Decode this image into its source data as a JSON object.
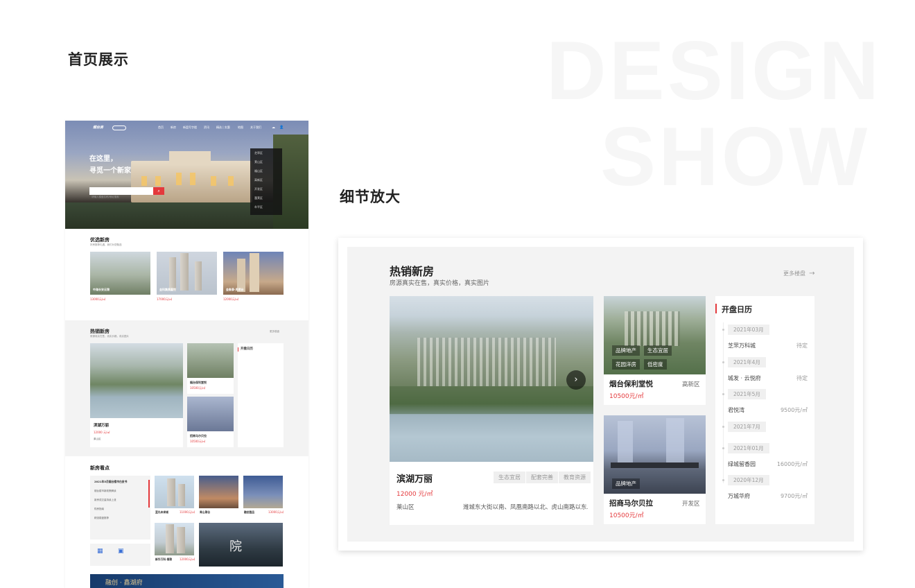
{
  "page": {
    "section_home": "首页展示",
    "section_detail": "细节放大",
    "ghost_line1": "DESIGN",
    "ghost_line2": "SHOW"
  },
  "mock": {
    "nav": [
      "首页",
      "新房",
      "新盘写字楼",
      "资讯",
      "精选 | 实惠",
      "地图",
      "关于我们"
    ],
    "hero_line1": "在这里，",
    "hero_line2": "寻觅一个新家",
    "search_placeholder": "请输入楼盘名称/地址搜索",
    "side_menu": [
      "芝罘区",
      "莱山区",
      "福山区",
      "高新区",
      "开发区",
      "蓬莱区",
      "牟平区"
    ],
    "featured_title": "优选新房",
    "featured_sub": "好房推荐礼遇，我们为您甄选",
    "featured": [
      {
        "name": "中海长安云锦",
        "price": "13000元/㎡"
      },
      {
        "name": "金科集美嘉悦",
        "price": "17000元/㎡"
      },
      {
        "name": "金象泰·凤栖台",
        "price": "12000元/㎡"
      }
    ],
    "hot_title": "热销新房",
    "hot_sub": "房源真实在售，真实价格，真实图片",
    "hot_more": "更多楼盘",
    "hot_main_name": "滨湖万丽",
    "hot_main_price": "12000 元/㎡",
    "hot_main_area": "莱山区",
    "hot_small": [
      {
        "name": "烟台保利堂悦",
        "price": "10500元/㎡"
      },
      {
        "name": "招商马尔贝拉",
        "price": "10500元/㎡"
      }
    ],
    "cal_title": "开盘日历",
    "news_title": "新房看点",
    "news_items": [
      "2021年5月烟台楼市白皮书",
      "烟台楼市新政策解读",
      "新房成交量持续上涨",
      "购房指南",
      "精选楼盘推荐"
    ],
    "news_cards": [
      {
        "name": "蓝光未来城",
        "price": "11000元/㎡"
      },
      {
        "name": "青山翠谷",
        "price": ""
      },
      {
        "name": "融创壹品",
        "price": "13000元/㎡"
      },
      {
        "name": "新华万科·翡翠",
        "price": "12000元/㎡"
      }
    ],
    "banner_text": "融创 · 鑫湖府"
  },
  "detail": {
    "title": "热销新房",
    "subtitle": "房源真实在售，真实价格，真实图片",
    "more": "更多楼盘",
    "main": {
      "name": "滨湖万丽",
      "price": "12000 元/㎡",
      "area": "莱山区",
      "address": "潍城东大街以南、凤凰南路以北、虎山南路以东...",
      "tags": [
        "生态宜居",
        "配套完善",
        "教育资源"
      ]
    },
    "side_cards": [
      {
        "name": "烟台保利堂悦",
        "district": "高新区",
        "price": "10500元/㎡",
        "tags": [
          "品牌地产",
          "生态宜居",
          "花园洋房",
          "低密度"
        ]
      },
      {
        "name": "招商马尔贝拉",
        "district": "开发区",
        "price": "10500元/㎡",
        "tags": [
          "品牌地产"
        ]
      }
    ],
    "calendar": {
      "title": "开盘日历",
      "entries": [
        {
          "date": "2021年03月",
          "name": "芝罘万科城",
          "status": "待定"
        },
        {
          "date": "2021年4月",
          "name": "城发 · 云悦府",
          "status": "待定"
        },
        {
          "date": "2021年5月",
          "name": "君悦湾",
          "status": "9500元/㎡"
        },
        {
          "date": "2021年7月",
          "name": "",
          "status": ""
        },
        {
          "date": "2021年01月",
          "name": "绿城留香园",
          "status": "16000元/㎡"
        },
        {
          "date": "2020年12月",
          "name": "万城华府",
          "status": "9700元/㎡"
        }
      ]
    }
  }
}
